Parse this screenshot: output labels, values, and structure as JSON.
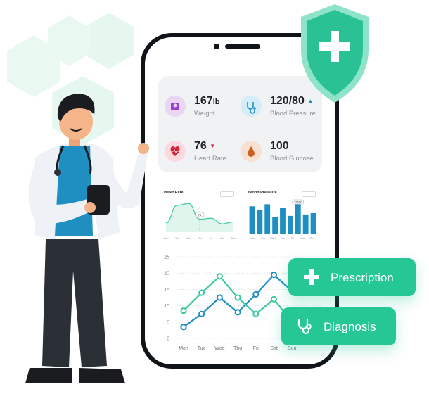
{
  "stats": {
    "weight": {
      "value": "167",
      "unit": "lb",
      "label": "Weight"
    },
    "blood_pressure": {
      "value": "120/80",
      "label": "Blood Pressure",
      "trend": "up",
      "trend_color": "#1f8fc2"
    },
    "heart_rate": {
      "value": "76",
      "label": "Heart Rate",
      "trend": "down",
      "trend_color": "#d0263f"
    },
    "blood_glucose": {
      "value": "100",
      "label": "Blood Glucose"
    }
  },
  "icons": {
    "weight": "scale-icon",
    "blood_pressure": "stethoscope-icon",
    "heart_rate": "heart-pulse-icon",
    "blood_glucose": "blood-drop-icon",
    "shield": "shield-plus-icon",
    "prescription": "plus-icon",
    "diagnosis": "stethoscope-icon"
  },
  "colors": {
    "accent_green": "#25c795",
    "shield_green": "#2ac195",
    "chart_blue": "#1f8fc2",
    "chart_teal": "#3fc7a0",
    "phone_frame": "#101418"
  },
  "heart_card": {
    "title": "Heart Rate",
    "tooltip": "76"
  },
  "bp_card": {
    "title": "Blood Pressure",
    "tooltip": "120/80"
  },
  "chart_data": [
    {
      "type": "area",
      "title": "Heart Rate",
      "categories": [
        "Mon",
        "Tue",
        "Wed",
        "Thu",
        "Fri",
        "Sat",
        "Sun"
      ],
      "values": [
        20,
        58,
        62,
        28,
        30,
        18,
        22
      ],
      "highlight": {
        "category": "Thu",
        "label": "76"
      }
    },
    {
      "type": "bar",
      "title": "Blood Pressure",
      "categories": [
        "Mon",
        "Tue",
        "Wed",
        "Thu",
        "Fri",
        "Sat",
        "Sun"
      ],
      "values": [
        80,
        70,
        86,
        48,
        76,
        52,
        86,
        56,
        60
      ],
      "highlight": {
        "label": "120/80"
      }
    },
    {
      "type": "line",
      "x": [
        "Mon",
        "Tue",
        "Wed",
        "Thu",
        "Fri",
        "Sat",
        "Sun"
      ],
      "ylim": [
        0,
        25
      ],
      "yticks": [
        "0",
        "5",
        "10",
        "15",
        "20",
        "25"
      ],
      "grid": true,
      "series": [
        {
          "color": "#1f8fc2",
          "values": [
            3.5,
            7.5,
            12.5,
            8,
            13.5,
            19.5,
            14.5
          ]
        },
        {
          "color": "#3fc7a0",
          "values": [
            8.5,
            14,
            19,
            12.5,
            7.5,
            12,
            5
          ]
        }
      ]
    }
  ],
  "badges": {
    "prescription": "Prescription",
    "diagnosis": "Diagnosis"
  }
}
